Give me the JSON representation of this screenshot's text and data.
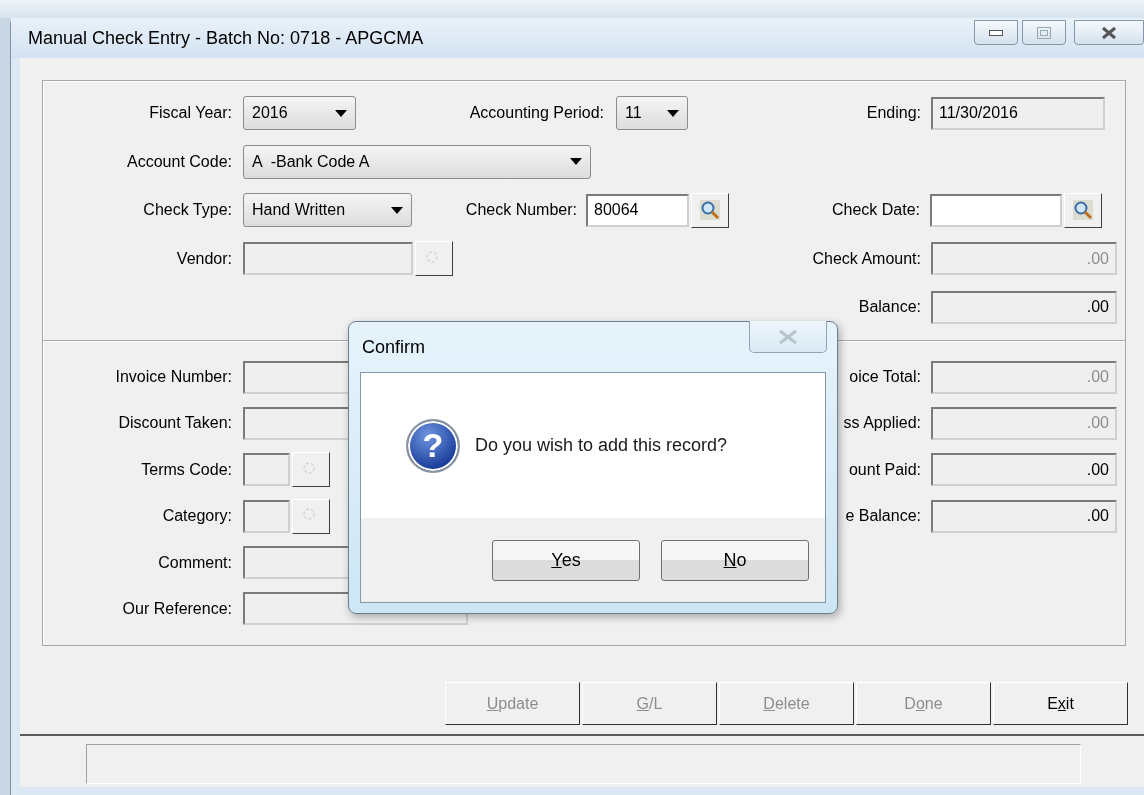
{
  "window": {
    "title": "Manual Check Entry - Batch No: 0718 - APGCMA"
  },
  "header": {
    "rows": [
      {
        "left": {
          "label": "Fiscal Year:",
          "kind": "dropdown",
          "value": "2016"
        },
        "middle": {
          "label": "Accounting Period:",
          "kind": "dropdown",
          "value": "11"
        },
        "right": {
          "label": "Ending:",
          "kind": "field",
          "value": "11/30/2016",
          "editable": false,
          "disabled": false
        }
      },
      {
        "left": {
          "label": "Account Code:",
          "kind": "dropdown",
          "value": "A  -Bank Code A"
        }
      },
      {
        "left": {
          "label": "Check Type:",
          "kind": "dropdown",
          "value": "Hand Written"
        },
        "middle": {
          "label": "Check Number:",
          "kind": "field",
          "value": "80064",
          "editable": true,
          "disabled": false,
          "lookup": {
            "disabled": false
          }
        },
        "right": {
          "label": "Check Date:",
          "kind": "field",
          "editable": true,
          "disabled": false,
          "lookup": {
            "disabled": false
          }
        }
      },
      {
        "left": {
          "label": "Vendor:",
          "kind": "field",
          "editable": false,
          "lookup": {
            "disabled": true
          }
        },
        "right": {
          "label": "Check Amount:",
          "kind": "amount",
          "value": ".00",
          "editable": false,
          "disabled": true
        }
      },
      {
        "right": {
          "label": "Balance:",
          "kind": "amount",
          "value": ".00",
          "editable": false,
          "disabled": false
        }
      }
    ]
  },
  "detail": {
    "rows": [
      {
        "left": {
          "label": "Invoice Number:",
          "kind": "field",
          "editable": false
        },
        "right": {
          "label": "oice Total:",
          "kind": "amount",
          "value": ".00",
          "editable": false,
          "disabled": true
        }
      },
      {
        "left": {
          "label": "Discount Taken:",
          "kind": "field",
          "editable": false
        },
        "right": {
          "label": "ss Applied:",
          "kind": "amount",
          "value": ".00",
          "editable": false,
          "disabled": true
        }
      },
      {
        "left": {
          "label": "Terms Code:",
          "kind": "field",
          "editable": false,
          "lookup": {
            "disabled": true
          }
        },
        "right": {
          "label": "ount Paid:",
          "kind": "amount",
          "value": ".00",
          "editable": false,
          "disabled": false
        }
      },
      {
        "left": {
          "label": "Category:",
          "kind": "field",
          "editable": false,
          "lookup": {
            "disabled": true
          }
        },
        "right": {
          "label": "e Balance:",
          "kind": "amount",
          "value": ".00",
          "editable": false,
          "disabled": false
        }
      },
      {
        "left": {
          "label": "Comment:",
          "kind": "field",
          "editable": false
        }
      },
      {
        "left": {
          "label": "Our Reference:",
          "kind": "field",
          "editable": false
        }
      }
    ]
  },
  "buttons": [
    {
      "key": "U",
      "after": "pdate",
      "disabled": true
    },
    {
      "key": "G",
      "after": "/L",
      "disabled": true
    },
    {
      "key": "D",
      "after": "elete",
      "disabled": true
    },
    {
      "before": "D",
      "key": "o",
      "after": "ne",
      "disabled": true
    },
    {
      "before": "E",
      "key": "x",
      "after": "it",
      "disabled": false
    }
  ],
  "dialog": {
    "title": "Confirm",
    "close_disabled": true,
    "icon_glyph": "?",
    "message": "Do you wish to add this record?",
    "buttons": [
      {
        "key": "Y",
        "after": "es",
        "disabled": false
      },
      {
        "key": "N",
        "after": "o",
        "disabled": false
      }
    ]
  }
}
